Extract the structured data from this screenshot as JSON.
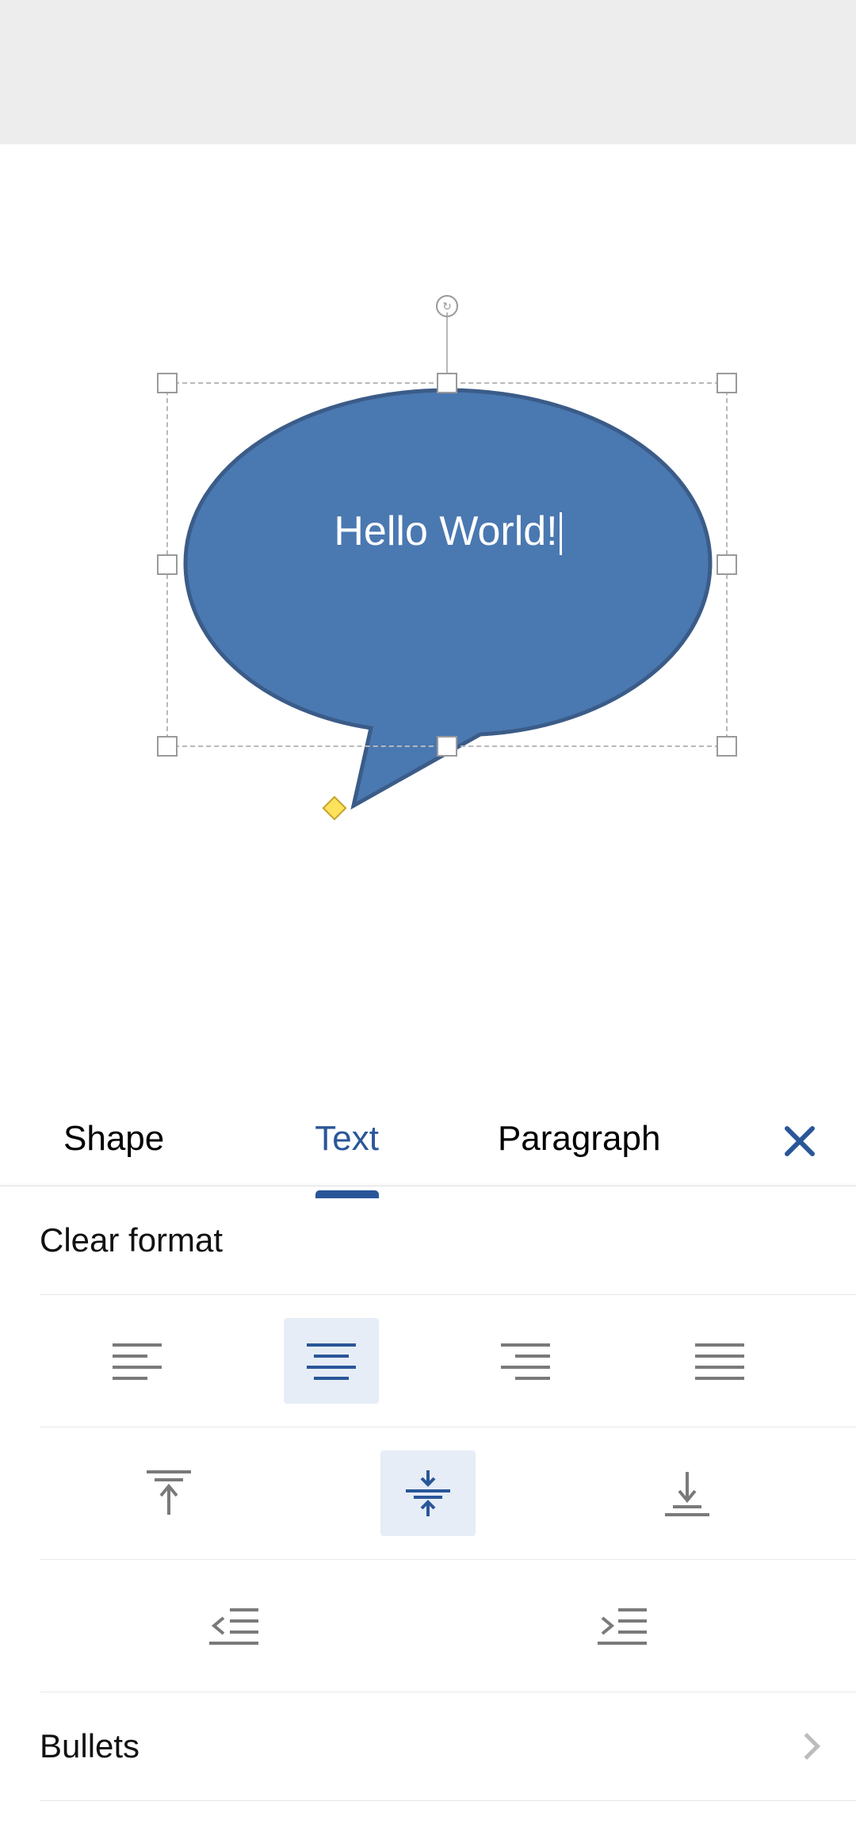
{
  "shape": {
    "text": "Hello World!",
    "fill": "#4a78b1",
    "stroke": "#3b5c88"
  },
  "tabs": {
    "shape": "Shape",
    "text": "Text",
    "paragraph": "Paragraph",
    "active": "text"
  },
  "actions": {
    "clear_format": "Clear format",
    "bullets": "Bullets"
  },
  "align_h": {
    "options": [
      "left",
      "center",
      "right",
      "justify"
    ],
    "selected": "center"
  },
  "align_v": {
    "options": [
      "top",
      "middle",
      "bottom"
    ],
    "selected": "middle"
  },
  "indent": {
    "options": [
      "decrease",
      "increase"
    ]
  },
  "colors": {
    "accent": "#2a5699",
    "icon": "#7a7a7a",
    "icon_active": "#2a5699"
  }
}
